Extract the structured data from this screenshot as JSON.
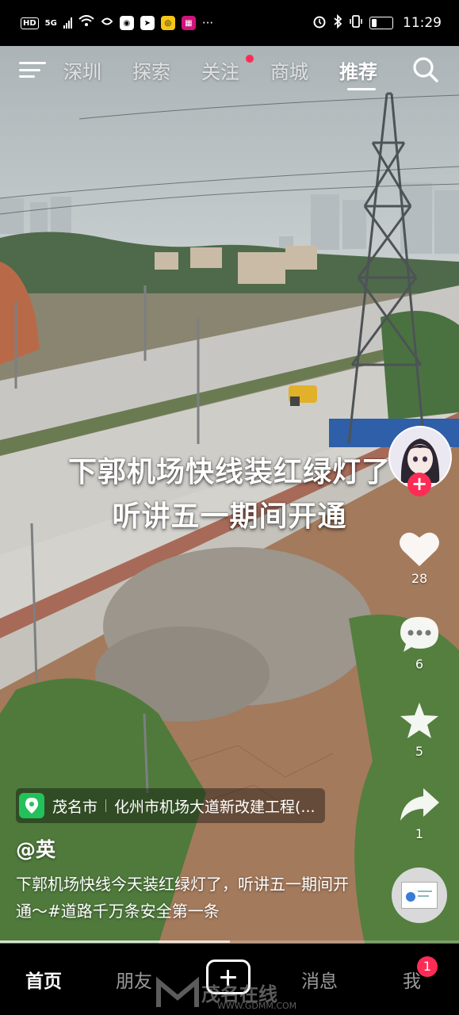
{
  "status_bar": {
    "left_chips": [
      "HD",
      "5G"
    ],
    "time": "11:29"
  },
  "top_nav": {
    "tabs": [
      {
        "label": "深圳",
        "active": false
      },
      {
        "label": "探索",
        "active": false
      },
      {
        "label": "关注",
        "active": false,
        "has_dot": true
      },
      {
        "label": "商城",
        "active": false
      },
      {
        "label": "推荐",
        "active": true
      }
    ]
  },
  "video": {
    "caption_line1": "下郭机场快线装红绿灯了",
    "caption_line2": "听讲五一期间开通",
    "progress": 0.5
  },
  "rail": {
    "likes": "28",
    "comments": "6",
    "favorites": "5",
    "shares": "1",
    "follow_symbol": "+"
  },
  "info": {
    "location_city": "茂名市",
    "location_place": "化州市机场大道新改建工程(...",
    "author": "@英",
    "description": "下郭机场快线今天装红绿灯了，听讲五一期间开通～#道路千万条安全第一条"
  },
  "bottom_nav": {
    "home": "首页",
    "friends": "朋友",
    "messages": "消息",
    "me": "我",
    "me_badge": "1"
  },
  "watermark": {
    "text": "茂名在线",
    "url": "WWW.GDMM.COM"
  },
  "colors": {
    "accent": "#fe2c55",
    "location_green": "#23c15b"
  }
}
